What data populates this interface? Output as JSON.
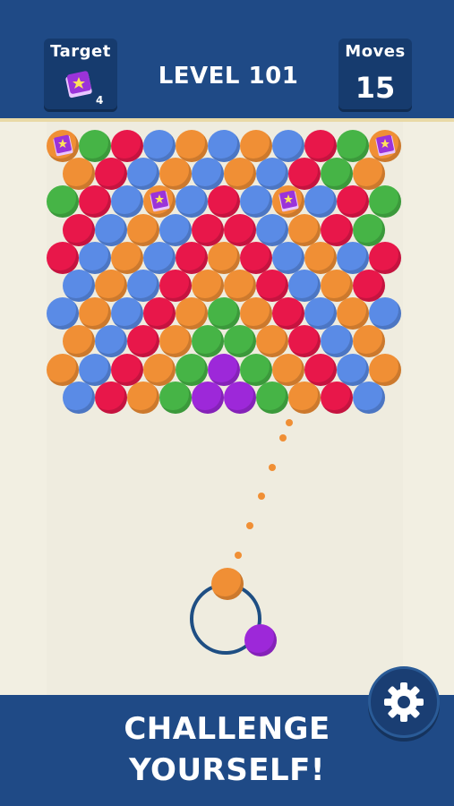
{
  "header": {
    "target_label": "Target",
    "target_count": "4",
    "level_title": "LEVEL 101",
    "moves_label": "Moves",
    "moves_value": "15",
    "target_icon": "book-icon"
  },
  "colors": {
    "header": "#1f4a86",
    "board": "#efecdf",
    "red": "#e8174a",
    "green": "#46b446",
    "blue": "#5a8be6",
    "orange": "#f08f35",
    "purple": "#9d28d9"
  },
  "board": {
    "rows": [
      [
        "book",
        "G",
        "R",
        "B",
        "O",
        "B",
        "O",
        "B",
        "R",
        "G",
        "book"
      ],
      [
        "O",
        "R",
        "B",
        "O",
        "B",
        "O",
        "B",
        "R",
        "G",
        "O"
      ],
      [
        "G",
        "R",
        "B",
        "book",
        "B",
        "R",
        "B",
        "book",
        "B",
        "R",
        "G"
      ],
      [
        "R",
        "B",
        "O",
        "B",
        "R",
        "R",
        "B",
        "O",
        "R",
        "G"
      ],
      [
        "R",
        "B",
        "O",
        "B",
        "R",
        "O",
        "R",
        "B",
        "O",
        "B",
        "R"
      ],
      [
        "B",
        "O",
        "B",
        "R",
        "O",
        "O",
        "R",
        "B",
        "O",
        "R"
      ],
      [
        "B",
        "O",
        "B",
        "R",
        "O",
        "G",
        "O",
        "R",
        "B",
        "O",
        "B"
      ],
      [
        "O",
        "B",
        "R",
        "O",
        "G",
        "G",
        "O",
        "R",
        "B",
        "O"
      ],
      [
        "O",
        "B",
        "R",
        "O",
        "G",
        "P",
        "G",
        "O",
        "R",
        "B",
        "O"
      ],
      [
        "B",
        "R",
        "O",
        "G",
        "P",
        "P",
        "G",
        "O",
        "R",
        "B"
      ]
    ]
  },
  "shooter": {
    "current": "orange",
    "next": "purple"
  },
  "footer": {
    "line1": "CHALLENGE",
    "line2": "YOURSELF!",
    "settings_icon": "gear-icon"
  }
}
